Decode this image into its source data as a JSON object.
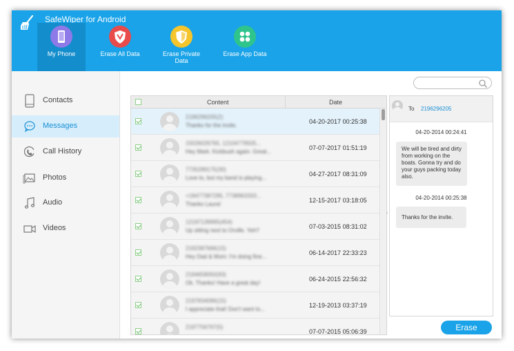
{
  "app": {
    "title": "SafeWiper for Android",
    "accent_color": "#1aa3e8",
    "logo_icon": "broom-icon"
  },
  "nav": [
    {
      "label": "My Phone",
      "icon": "phone-icon",
      "color": "#8e79e8",
      "active": true
    },
    {
      "label": "Erase All Data",
      "icon": "erase-shield-icon",
      "color": "#e94b4b",
      "active": false
    },
    {
      "label": "Erase Private Data",
      "icon": "private-shield-icon",
      "color": "#f5c52b",
      "active": false
    },
    {
      "label": "Erase App Data",
      "icon": "apps-grid-icon",
      "color": "#2ec48b",
      "active": false
    }
  ],
  "sidebar": {
    "items": [
      {
        "label": "Contacts",
        "icon": "contacts-icon",
        "active": false
      },
      {
        "label": "Messages",
        "icon": "messages-icon",
        "active": true
      },
      {
        "label": "Call History",
        "icon": "call-history-icon",
        "active": false
      },
      {
        "label": "Photos",
        "icon": "photos-icon",
        "active": false
      },
      {
        "label": "Audio",
        "icon": "audio-icon",
        "active": false
      },
      {
        "label": "Videos",
        "icon": "videos-icon",
        "active": false
      }
    ]
  },
  "search": {
    "placeholder": "",
    "value": ""
  },
  "table": {
    "columns": [
      "Content",
      "Date"
    ],
    "rows": [
      {
        "name": "2196296205(2)",
        "preview": "Thanks for the invite.",
        "date": "04-20-2017",
        "time": "00:25:38",
        "selected": true
      },
      {
        "name": "15026026765, 12104779505...",
        "preview": "Hey Mark. Kickbush again. Great...",
        "date": "07-07-2017",
        "time": "01:51:19",
        "selected": false
      },
      {
        "name": "7735289175(30)",
        "preview": "Love to, but my band is playing...",
        "date": "04-27-2017",
        "time": "08:31:09",
        "selected": false
      },
      {
        "name": "+18477387295, 7738963333...",
        "preview": "Thanks Laura!",
        "date": "12-15-2017",
        "time": "03:18:05",
        "selected": false
      },
      {
        "name": "12197139995(454)",
        "preview": "Up sitting next to Orville. Yeh?",
        "date": "07-03-2015",
        "time": "08:31:02",
        "selected": false
      },
      {
        "name": "2192387666(15)",
        "preview": "Hey Dad & Mom: I'm doing fine...",
        "date": "06-14-2017",
        "time": "22:33:23",
        "selected": false
      },
      {
        "name": "2194658050(93)",
        "preview": "Ok. Thanks! Have a great day!",
        "date": "06-24-2015",
        "time": "22:56:32",
        "selected": false
      },
      {
        "name": "2197834096(15)",
        "preview": "I appreciate that! Don't want to...",
        "date": "12-19-2013",
        "time": "03:37:19",
        "selected": false
      },
      {
        "name": "2197756767(5)",
        "preview": "",
        "date": "07-07-2015",
        "time": "05:06:39",
        "selected": false
      }
    ]
  },
  "conversation": {
    "to_label": "To",
    "number": "2196296205",
    "messages": [
      {
        "time": "04-20-2014 00:24:41",
        "text": "We will be tired and dirty from working on the boats.  Gonna try and do your guys packing today also."
      },
      {
        "time": "04-20-2014 00:25:38",
        "text": "Thanks for the invite."
      }
    ]
  },
  "erase_button": {
    "label": "Erase"
  }
}
